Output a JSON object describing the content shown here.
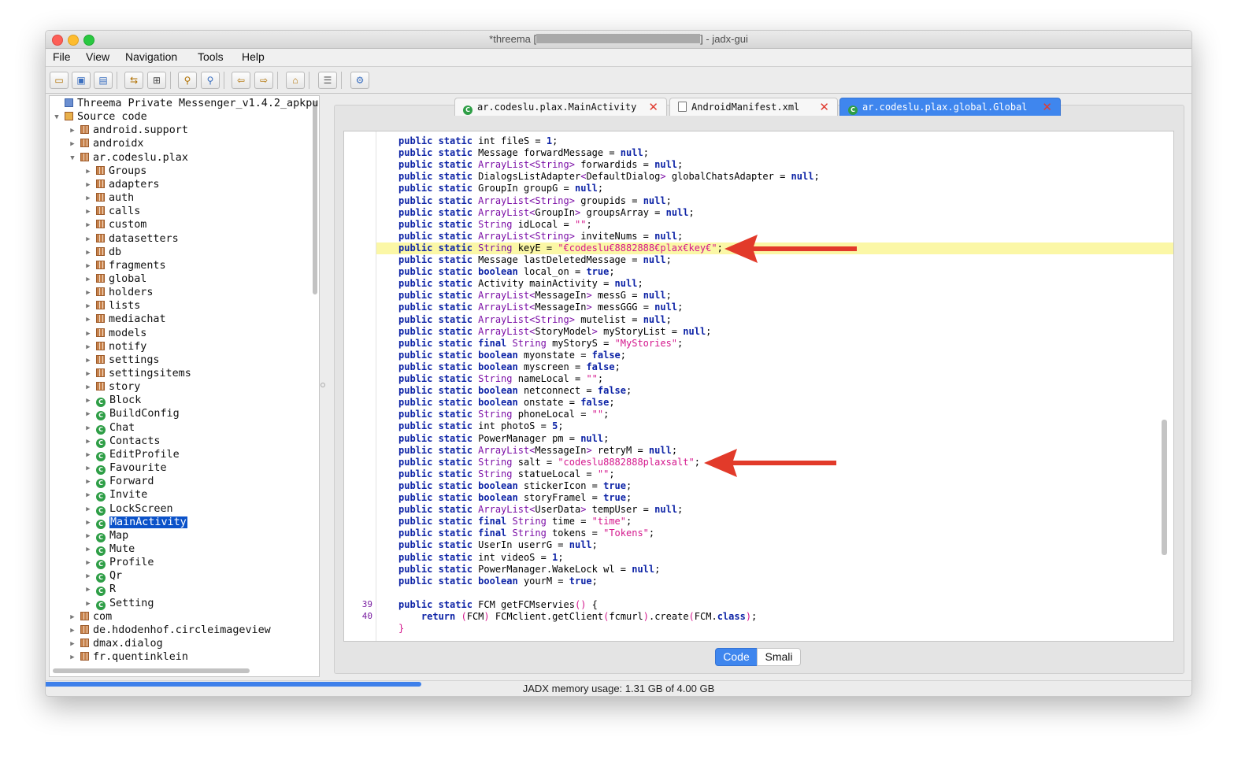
{
  "window": {
    "title_prefix": "*threema [",
    "title_suffix": "] - jadx-gui",
    "traffic_lights": [
      "close",
      "minimize",
      "zoom"
    ]
  },
  "menu": [
    "File",
    "View",
    "Navigation",
    "Tools",
    "Help"
  ],
  "toolbar_icons": [
    "open-icon",
    "save-icon",
    "save-all-icon",
    "sync-icon",
    "flatten-icon",
    "search-icon",
    "find-icon",
    "back-icon",
    "forward-icon",
    "deobfuscate-icon",
    "log-icon",
    "preferences-icon"
  ],
  "tree": {
    "root": "Threema Private Messenger_v1.4.2_apkpu",
    "source_code": "Source code",
    "top_packages": [
      "android.support",
      "androidx"
    ],
    "main_package": "ar.codeslu.plax",
    "subpackages": [
      "Groups",
      "adapters",
      "auth",
      "calls",
      "custom",
      "datasetters",
      "db",
      "fragments",
      "global",
      "holders",
      "lists",
      "mediachat",
      "models",
      "notify",
      "settings",
      "settingsitems",
      "story"
    ],
    "classes": [
      "Block",
      "BuildConfig",
      "Chat",
      "Contacts",
      "EditProfile",
      "Favourite",
      "Forward",
      "Invite",
      "LockScreen",
      "MainActivity",
      "Map",
      "Mute",
      "Profile",
      "Qr",
      "R",
      "Setting"
    ],
    "selected": "MainActivity",
    "bottom_packages": [
      "com",
      "de.hdodenhof.circleimageview",
      "dmax.dialog",
      "fr.quentinklein"
    ]
  },
  "tabs": [
    {
      "label": "ar.codeslu.plax.MainActivity",
      "icon": "class-icon",
      "active": false
    },
    {
      "label": "AndroidManifest.xml",
      "icon": "xml-file-icon",
      "active": false
    },
    {
      "label": "ar.codeslu.plax.global.Global",
      "icon": "class-icon",
      "active": true
    }
  ],
  "code": {
    "lines": [
      [
        [
          "kw",
          "public static "
        ],
        [
          "",
          "int fileS = "
        ],
        [
          "kw",
          "1"
        ],
        [
          "",
          ";"
        ]
      ],
      [
        [
          "kw",
          "public static "
        ],
        [
          "",
          "Message forwardMessage = "
        ],
        [
          "kw",
          "null"
        ],
        [
          "",
          ";"
        ]
      ],
      [
        [
          "kw",
          "public static "
        ],
        [
          "ty",
          "ArrayList<String>"
        ],
        [
          "",
          " forwardids = "
        ],
        [
          "kw",
          "null"
        ],
        [
          "",
          ";"
        ]
      ],
      [
        [
          "kw",
          "public static "
        ],
        [
          "",
          "DialogsListAdapter"
        ],
        [
          "ty",
          "<"
        ],
        [
          "",
          "DefaultDialog"
        ],
        [
          "ty",
          ">"
        ],
        [
          "",
          " globalChatsAdapter = "
        ],
        [
          "kw",
          "null"
        ],
        [
          "",
          ";"
        ]
      ],
      [
        [
          "kw",
          "public static "
        ],
        [
          "",
          "GroupIn groupG = "
        ],
        [
          "kw",
          "null"
        ],
        [
          "",
          ";"
        ]
      ],
      [
        [
          "kw",
          "public static "
        ],
        [
          "ty",
          "ArrayList<String>"
        ],
        [
          "",
          " groupids = "
        ],
        [
          "kw",
          "null"
        ],
        [
          "",
          ";"
        ]
      ],
      [
        [
          "kw",
          "public static "
        ],
        [
          "ty",
          "ArrayList<"
        ],
        [
          "",
          "GroupIn"
        ],
        [
          "ty",
          ">"
        ],
        [
          "",
          " groupsArray = "
        ],
        [
          "kw",
          "null"
        ],
        [
          "",
          ";"
        ]
      ],
      [
        [
          "kw",
          "public static "
        ],
        [
          "ty",
          "String"
        ],
        [
          "",
          " idLocal = "
        ],
        [
          "st",
          "\"\""
        ],
        [
          "",
          ";"
        ]
      ],
      [
        [
          "kw",
          "public static "
        ],
        [
          "ty",
          "ArrayList<String>"
        ],
        [
          "",
          " inviteNums = "
        ],
        [
          "kw",
          "null"
        ],
        [
          "",
          ";"
        ]
      ],
      [
        [
          "kw",
          "public static "
        ],
        [
          "ty",
          "String"
        ],
        [
          "",
          " keyE = "
        ],
        [
          "st",
          "\"€codeslu€8882888€plax€key€\""
        ],
        [
          "",
          ";"
        ]
      ],
      [
        [
          "kw",
          "public static "
        ],
        [
          "",
          "Message lastDeletedMessage = "
        ],
        [
          "kw",
          "null"
        ],
        [
          "",
          ";"
        ]
      ],
      [
        [
          "kw",
          "public static boolean "
        ],
        [
          "",
          "local_on = "
        ],
        [
          "kw",
          "true"
        ],
        [
          "",
          ";"
        ]
      ],
      [
        [
          "kw",
          "public static "
        ],
        [
          "",
          "Activity mainActivity = "
        ],
        [
          "kw",
          "null"
        ],
        [
          "",
          ";"
        ]
      ],
      [
        [
          "kw",
          "public static "
        ],
        [
          "ty",
          "ArrayList<"
        ],
        [
          "",
          "MessageIn"
        ],
        [
          "ty",
          ">"
        ],
        [
          "",
          " messG = "
        ],
        [
          "kw",
          "null"
        ],
        [
          "",
          ";"
        ]
      ],
      [
        [
          "kw",
          "public static "
        ],
        [
          "ty",
          "ArrayList<"
        ],
        [
          "",
          "MessageIn"
        ],
        [
          "ty",
          ">"
        ],
        [
          "",
          " messGGG = "
        ],
        [
          "kw",
          "null"
        ],
        [
          "",
          ";"
        ]
      ],
      [
        [
          "kw",
          "public static "
        ],
        [
          "ty",
          "ArrayList<String>"
        ],
        [
          "",
          " mutelist = "
        ],
        [
          "kw",
          "null"
        ],
        [
          "",
          ";"
        ]
      ],
      [
        [
          "kw",
          "public static "
        ],
        [
          "ty",
          "ArrayList<"
        ],
        [
          "",
          "StoryModel"
        ],
        [
          "ty",
          ">"
        ],
        [
          "",
          " myStoryList = "
        ],
        [
          "kw",
          "null"
        ],
        [
          "",
          ";"
        ]
      ],
      [
        [
          "kw",
          "public static final "
        ],
        [
          "ty",
          "String"
        ],
        [
          "",
          " myStoryS = "
        ],
        [
          "st",
          "\"MyStories\""
        ],
        [
          "",
          ";"
        ]
      ],
      [
        [
          "kw",
          "public static boolean "
        ],
        [
          "",
          "myonstate = "
        ],
        [
          "kw",
          "false"
        ],
        [
          "",
          ";"
        ]
      ],
      [
        [
          "kw",
          "public static boolean "
        ],
        [
          "",
          "myscreen = "
        ],
        [
          "kw",
          "false"
        ],
        [
          "",
          ";"
        ]
      ],
      [
        [
          "kw",
          "public static "
        ],
        [
          "ty",
          "String"
        ],
        [
          "",
          " nameLocal = "
        ],
        [
          "st",
          "\"\""
        ],
        [
          "",
          ";"
        ]
      ],
      [
        [
          "kw",
          "public static boolean "
        ],
        [
          "",
          "netconnect = "
        ],
        [
          "kw",
          "false"
        ],
        [
          "",
          ";"
        ]
      ],
      [
        [
          "kw",
          "public static boolean "
        ],
        [
          "",
          "onstate = "
        ],
        [
          "kw",
          "false"
        ],
        [
          "",
          ";"
        ]
      ],
      [
        [
          "kw",
          "public static "
        ],
        [
          "ty",
          "String"
        ],
        [
          "",
          " phoneLocal = "
        ],
        [
          "st",
          "\"\""
        ],
        [
          "",
          ";"
        ]
      ],
      [
        [
          "kw",
          "public static "
        ],
        [
          "",
          "int photoS = "
        ],
        [
          "kw",
          "5"
        ],
        [
          "",
          ";"
        ]
      ],
      [
        [
          "kw",
          "public static "
        ],
        [
          "",
          "PowerManager pm = "
        ],
        [
          "kw",
          "null"
        ],
        [
          "",
          ";"
        ]
      ],
      [
        [
          "kw",
          "public static "
        ],
        [
          "ty",
          "ArrayList<"
        ],
        [
          "",
          "MessageIn"
        ],
        [
          "ty",
          ">"
        ],
        [
          "",
          " retryM = "
        ],
        [
          "kw",
          "null"
        ],
        [
          "",
          ";"
        ]
      ],
      [
        [
          "kw",
          "public static "
        ],
        [
          "ty",
          "String"
        ],
        [
          "",
          " salt = "
        ],
        [
          "st",
          "\"codeslu8882888plaxsalt\""
        ],
        [
          "",
          ";"
        ]
      ],
      [
        [
          "kw",
          "public static "
        ],
        [
          "ty",
          "String"
        ],
        [
          "",
          " statueLocal = "
        ],
        [
          "st",
          "\"\""
        ],
        [
          "",
          ";"
        ]
      ],
      [
        [
          "kw",
          "public static boolean "
        ],
        [
          "",
          "stickerIcon = "
        ],
        [
          "kw",
          "true"
        ],
        [
          "",
          ";"
        ]
      ],
      [
        [
          "kw",
          "public static boolean "
        ],
        [
          "",
          "storyFramel = "
        ],
        [
          "kw",
          "true"
        ],
        [
          "",
          ";"
        ]
      ],
      [
        [
          "kw",
          "public static "
        ],
        [
          "ty",
          "ArrayList<"
        ],
        [
          "",
          "UserData"
        ],
        [
          "ty",
          ">"
        ],
        [
          "",
          " tempUser = "
        ],
        [
          "kw",
          "null"
        ],
        [
          "",
          ";"
        ]
      ],
      [
        [
          "kw",
          "public static final "
        ],
        [
          "ty",
          "String"
        ],
        [
          "",
          " time = "
        ],
        [
          "st",
          "\"time\""
        ],
        [
          "",
          ";"
        ]
      ],
      [
        [
          "kw",
          "public static final "
        ],
        [
          "ty",
          "String"
        ],
        [
          "",
          " tokens = "
        ],
        [
          "st",
          "\"Tokens\""
        ],
        [
          "",
          ";"
        ]
      ],
      [
        [
          "kw",
          "public static "
        ],
        [
          "",
          "UserIn userrG = "
        ],
        [
          "kw",
          "null"
        ],
        [
          "",
          ";"
        ]
      ],
      [
        [
          "kw",
          "public static "
        ],
        [
          "",
          "int videoS = "
        ],
        [
          "kw",
          "1"
        ],
        [
          "",
          ";"
        ]
      ],
      [
        [
          "kw",
          "public static "
        ],
        [
          "",
          "PowerManager.WakeLock wl = "
        ],
        [
          "kw",
          "null"
        ],
        [
          "",
          ";"
        ]
      ],
      [
        [
          "kw",
          "public static boolean "
        ],
        [
          "",
          "yourM = "
        ],
        [
          "kw",
          "true"
        ],
        [
          "",
          ";"
        ]
      ],
      [],
      [
        [
          "kw",
          "public static "
        ],
        [
          "",
          "FCM getFCMservies"
        ],
        [
          "st",
          "()"
        ],
        [
          "",
          " {"
        ]
      ],
      [
        [
          "kw",
          "    return "
        ],
        [
          "st",
          "("
        ],
        [
          "",
          "FCM"
        ],
        [
          "st",
          ")"
        ],
        [
          "",
          " FCMclient.getClient"
        ],
        [
          "st",
          "("
        ],
        [
          "",
          "fcmurl"
        ],
        [
          "st",
          ")"
        ],
        [
          "",
          ".create"
        ],
        [
          "st",
          "("
        ],
        [
          "",
          "FCM."
        ],
        [
          "kw",
          "class"
        ],
        [
          "st",
          ")"
        ],
        [
          "",
          ";"
        ]
      ],
      [
        [
          "st",
          "}"
        ]
      ]
    ],
    "line_numbers": [
      {
        "index": 39,
        "label": "39"
      },
      {
        "index": 40,
        "label": "40"
      }
    ],
    "highlighted_line": 9,
    "arrow_lines": [
      9,
      27
    ]
  },
  "view_toggle": {
    "code": "Code",
    "smali": "Smali",
    "selected": "Code"
  },
  "status": {
    "memory_text": "JADX memory usage: 1.31 GB of 4.00 GB",
    "memory_used_fraction": 0.3275
  },
  "colors": {
    "selection": "#0b52c9",
    "active_tab": "#3f86ee",
    "keyword": "#0d23a6",
    "type": "#7b0ea6",
    "string": "#d4168c",
    "highlight": "#fbf7a6",
    "arrow": "#e23a2a"
  }
}
